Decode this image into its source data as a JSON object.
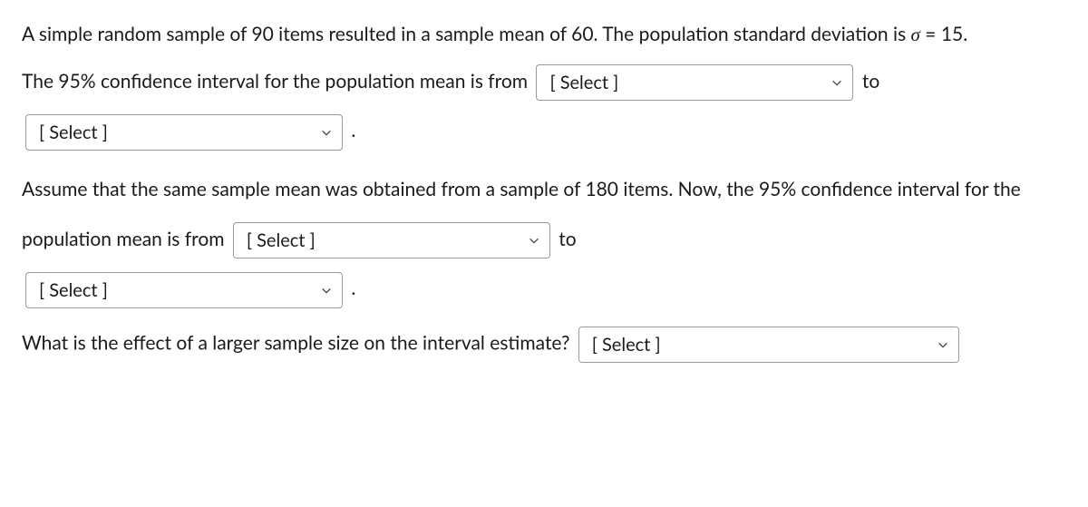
{
  "q1_text_a": "A simple random sample of 90 items resulted in a sample mean of 60. The population standard deviation is ",
  "sigma_symbol": "σ",
  "q1_text_b": " = 15.",
  "q2_text_a": "The 95% confidence interval for the population mean is from ",
  "select_placeholder": "[ Select ]",
  "word_to": " to ",
  "period": ".",
  "q3_text_a": "Assume that the same sample mean was obtained from a sample of 180 items. Now, the 95% confidence interval for the population mean is from ",
  "q4_text": "What is the effect of a larger sample size on the interval estimate? "
}
